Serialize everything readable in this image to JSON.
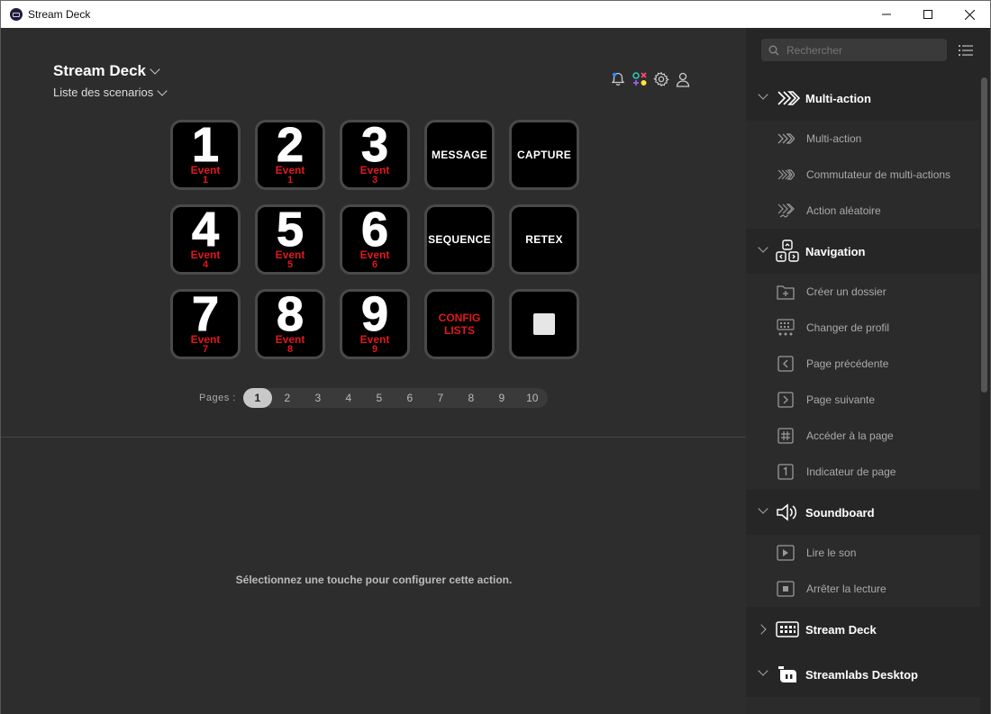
{
  "window": {
    "title": "Stream Deck"
  },
  "header": {
    "device_name": "Stream Deck",
    "profile": "Liste des scenarios"
  },
  "keys": [
    {
      "num": "1",
      "ev": "Event",
      "evn": "1"
    },
    {
      "num": "2",
      "ev": "Event",
      "evn": "1"
    },
    {
      "num": "3",
      "ev": "Event",
      "evn": "3"
    },
    {
      "label": "MESSAGE"
    },
    {
      "label": "CAPTURE"
    },
    {
      "num": "4",
      "ev": "Event",
      "evn": "4"
    },
    {
      "num": "5",
      "ev": "Event",
      "evn": "5"
    },
    {
      "num": "6",
      "ev": "Event",
      "evn": "6"
    },
    {
      "label": "SEQUENCE"
    },
    {
      "label": "RETEX"
    },
    {
      "num": "7",
      "ev": "Event",
      "evn": "7"
    },
    {
      "num": "8",
      "ev": "Event",
      "evn": "8"
    },
    {
      "num": "9",
      "ev": "Event",
      "evn": "9"
    },
    {
      "label_red_1": "CONFIG",
      "label_red_2": "LISTS"
    },
    {
      "icon": "stop-square-icon"
    }
  ],
  "pager": {
    "label": "Pages :",
    "pages": [
      "1",
      "2",
      "3",
      "4",
      "5",
      "6",
      "7",
      "8",
      "9",
      "10"
    ],
    "active": "1"
  },
  "property_inspector": {
    "message": "Sélectionnez une touche pour configurer cette action."
  },
  "sidebar": {
    "search_placeholder": "Rechercher",
    "categories": [
      {
        "label": "Multi-action",
        "items": [
          "Multi-action",
          "Commutateur de multi-actions",
          "Action aléatoire"
        ]
      },
      {
        "label": "Navigation",
        "items": [
          "Créer un dossier",
          "Changer de profil",
          "Page précédente",
          "Page suivante",
          "Accéder à la page",
          "Indicateur de page"
        ]
      },
      {
        "label": "Soundboard",
        "items": [
          "Lire le son",
          "Arrêter la lecture"
        ]
      },
      {
        "label": "Stream Deck",
        "items": []
      },
      {
        "label": "Streamlabs Desktop",
        "items": []
      }
    ]
  },
  "colors": {
    "accent_red": "#e0181e",
    "background": "#2d2d2d",
    "sidebar": "#262626"
  }
}
